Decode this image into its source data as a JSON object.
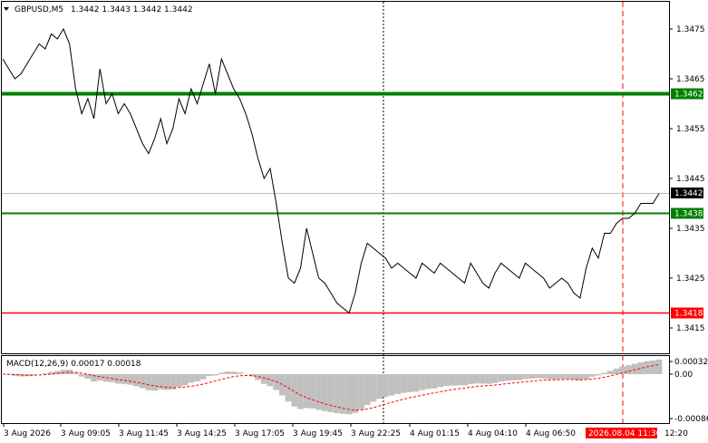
{
  "header": {
    "symbol_label": "GBPUSD,M5",
    "ohlc_label": "1.3442 1.3443 1.3442 1.3442",
    "dropdown_icon": "triangle-down-icon"
  },
  "colors": {
    "price_line": "#000000",
    "green_level": "#008000",
    "red_level": "#ff0000",
    "macd_hist": "#c0c0c0",
    "macd_signal": "#ff0000",
    "current_price_bg": "#000000",
    "timestamp_bg": "#ff0000"
  },
  "price_axis": {
    "ticks": [
      "1.3475",
      "1.3465",
      "1.3455",
      "1.3445",
      "1.3435",
      "1.3425",
      "1.3415"
    ],
    "current_price_label": "1.3442"
  },
  "levels": [
    {
      "label": "1.3462",
      "color": "#008000",
      "style": "thick"
    },
    {
      "label": "1.3438",
      "color": "#008000",
      "style": "medium"
    },
    {
      "label": "1.3418",
      "color": "#ff0000",
      "style": "thin"
    }
  ],
  "macd": {
    "title": "MACD(12,26,9) 0.00017 0.00018",
    "ticks": [
      "0.00032",
      "0.00",
      "-0.00086"
    ]
  },
  "time_axis": {
    "labels": [
      "3 Aug 2026",
      "3 Aug 09:05",
      "3 Aug 11:45",
      "3 Aug 14:25",
      "3 Aug 17:05",
      "3 Aug 19:45",
      "3 Aug 22:25",
      "4 Aug 01:15",
      "4 Aug 04:10",
      "4 Aug 06:50"
    ],
    "highlight_label": "2026.08.04 11:30",
    "end_label": "12:20"
  },
  "chart_data": {
    "type": "line",
    "series": [
      {
        "values": [
          1.3469,
          1.3467,
          1.3465,
          1.3466,
          1.3468,
          1.347,
          1.3472,
          1.3471,
          1.3474,
          1.3473,
          1.3475,
          1.3472,
          1.3463,
          1.3458,
          1.3461,
          1.3457,
          1.3467,
          1.346,
          1.3462,
          1.3458,
          1.346,
          1.3458,
          1.3455,
          1.3452,
          1.345,
          1.3453,
          1.3457,
          1.3452,
          1.3455,
          1.3461,
          1.3458,
          1.3463,
          1.346,
          1.3464,
          1.3468,
          1.3462,
          1.3469,
          1.3466,
          1.3463,
          1.3461,
          1.3458,
          1.3454,
          1.3449,
          1.3445,
          1.3447,
          1.344,
          1.3432,
          1.3425,
          1.3424,
          1.3427,
          1.3435,
          1.343,
          1.3425,
          1.3424,
          1.3422,
          1.342,
          1.3419,
          1.3418,
          1.3422,
          1.3428,
          1.3432,
          1.3431,
          1.343,
          1.3429,
          1.3427,
          1.3428,
          1.3427,
          1.3426,
          1.3425,
          1.3428,
          1.3427,
          1.3426,
          1.3428,
          1.3427,
          1.3426,
          1.3425,
          1.3424,
          1.3428,
          1.3426,
          1.3424,
          1.3423,
          1.3426,
          1.3428,
          1.3427,
          1.3426,
          1.3425,
          1.3428,
          1.3427,
          1.3426,
          1.3425,
          1.3423,
          1.3424,
          1.3425,
          1.3424,
          1.3422,
          1.3421,
          1.3427,
          1.3431,
          1.3429,
          1.3434,
          1.3434,
          1.3436,
          1.3437,
          1.3437,
          1.3438,
          1.344,
          1.344,
          1.344,
          1.3442
        ]
      }
    ],
    "ylim": [
      1.341,
      1.348
    ]
  }
}
